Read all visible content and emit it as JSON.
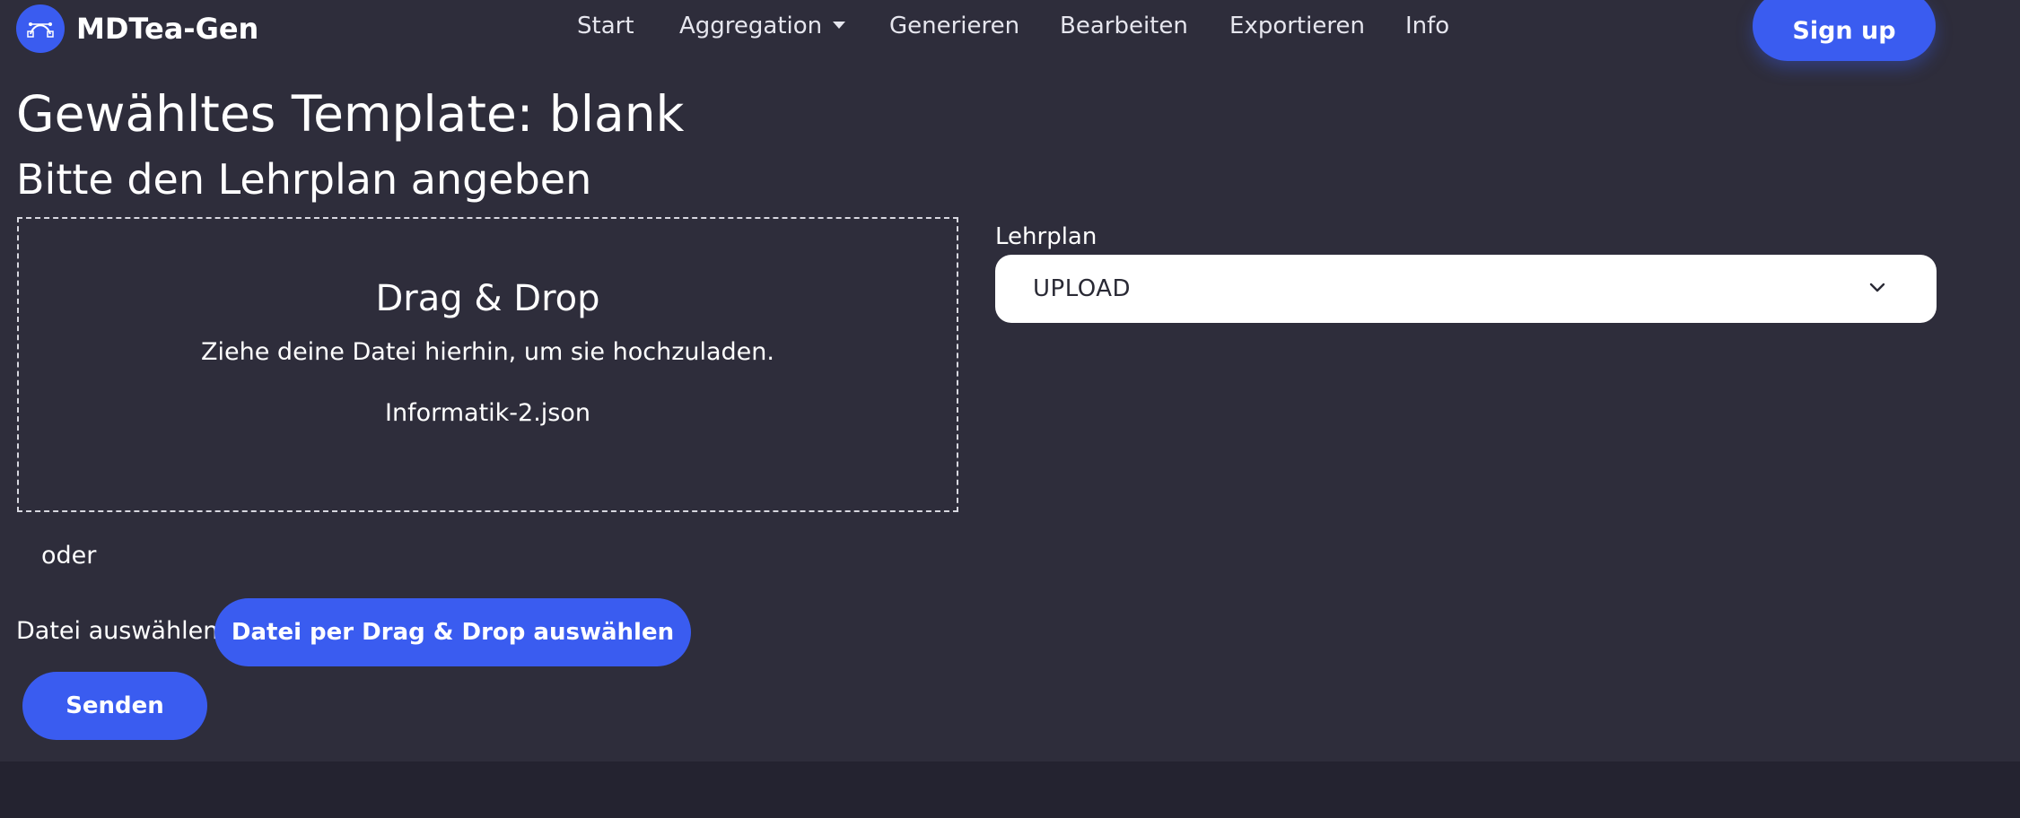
{
  "brand": {
    "name": "MDTea-Gen",
    "logo_icon": "bezier-curve-icon"
  },
  "nav": {
    "items": [
      {
        "label": "Start"
      },
      {
        "label": "Aggregation",
        "has_dropdown": true
      },
      {
        "label": "Generieren"
      },
      {
        "label": "Bearbeiten"
      },
      {
        "label": "Exportieren"
      },
      {
        "label": "Info"
      }
    ],
    "signup_label": "Sign up"
  },
  "page": {
    "title": "Gewähltes Template: blank",
    "subtitle": "Bitte den Lehrplan angeben"
  },
  "dropzone": {
    "title": "Drag & Drop",
    "instruction": "Ziehe deine Datei hierhin, um sie hochzuladen.",
    "file_name": "Informatik-2.json"
  },
  "lehrplan_select": {
    "label": "Lehrplan",
    "selected": "UPLOAD"
  },
  "upload": {
    "or_label": "oder",
    "file_label": "Datei auswählen:",
    "file_button_label": "Datei per Drag & Drop auswählen",
    "submit_label": "Senden"
  },
  "colors": {
    "accent": "#3a5cf0",
    "background": "#2e2d3b",
    "footer": "#242330",
    "text": "#ffffff"
  }
}
